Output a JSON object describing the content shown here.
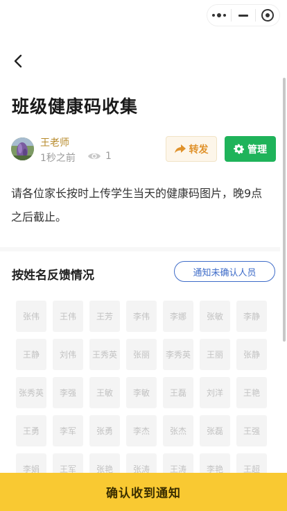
{
  "nav": {
    "capsule_icons": [
      "more-dots-icon",
      "minimize-icon",
      "close-target-icon"
    ],
    "back_icon": "chevron-left-icon"
  },
  "post": {
    "title": "班级健康码收集",
    "author": "王老师",
    "time": "1秒之前",
    "views": "1",
    "forward_label": "转发",
    "manage_label": "管理",
    "description": "请各位家长按时上传学生当天的健康码图片，晚9点之后截止。"
  },
  "feedback": {
    "section_title": "按姓名反馈情况",
    "notify_label": "通知未确认人员",
    "names": [
      "张伟",
      "王伟",
      "王芳",
      "李伟",
      "李娜",
      "张敏",
      "李静",
      "王静",
      "刘伟",
      "王秀英",
      "张丽",
      "李秀英",
      "王丽",
      "张静",
      "张秀英",
      "李强",
      "王敏",
      "李敏",
      "王磊",
      "刘洋",
      "王艳",
      "王勇",
      "李军",
      "张勇",
      "李杰",
      "张杰",
      "张磊",
      "王强",
      "李娟",
      "王军",
      "张艳",
      "张涛",
      "王涛",
      "李艳",
      "王超"
    ]
  },
  "footer": {
    "confirm_label": "确认收到通知"
  },
  "colors": {
    "author": "#b78a2a",
    "forward_bg": "#fdf6ea",
    "forward_text": "#e0922b",
    "manage_bg": "#1fb35a",
    "notify_border": "#3d6bc8",
    "confirm_bg": "#f9c932"
  }
}
